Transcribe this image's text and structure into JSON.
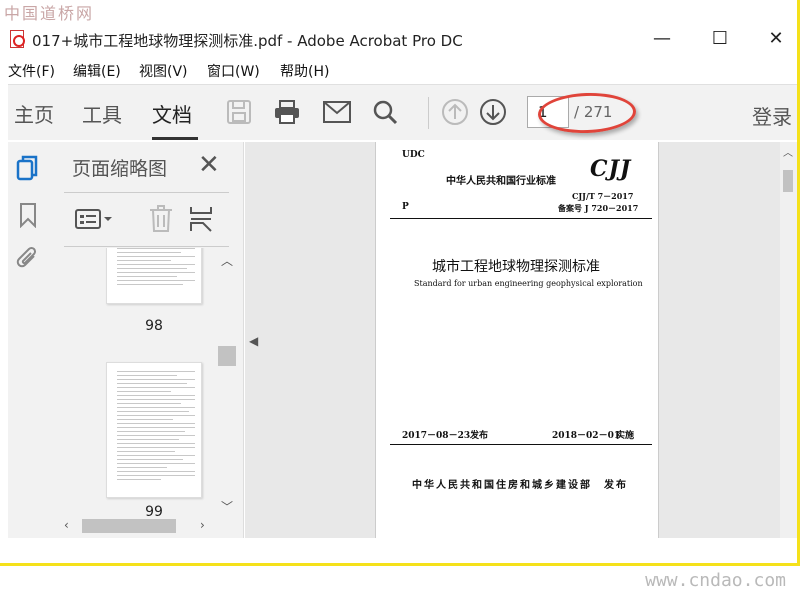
{
  "watermarks": {
    "top": "中国道桥网",
    "bottom": "www.cndao.com"
  },
  "window": {
    "title": "017+城市工程地球物理探测标准.pdf - Adobe Acrobat Pro DC",
    "minimize": "—",
    "maximize": "☐",
    "close": "✕"
  },
  "menu": [
    "文件(F)",
    "编辑(E)",
    "视图(V)",
    "窗口(W)",
    "帮助(H)"
  ],
  "toolbar": {
    "tabs": [
      "主页",
      "工具",
      "文档"
    ],
    "active_tab": "文档",
    "page_current": "1",
    "page_total": "/ 271",
    "login": "登录"
  },
  "panel": {
    "title": "页面缩略图",
    "close": "✕",
    "thumbnails": [
      {
        "label": "98"
      },
      {
        "label": "99"
      }
    ]
  },
  "document": {
    "udc": "UDC",
    "p": "P",
    "header": "中华人民共和国行业标准",
    "logo": "CJJ",
    "code": "CJJ/T 7－2017",
    "record": "备案号 J 720－2017",
    "title_cn": "城市工程地球物理探测标准",
    "title_en": "Standard for urban engineering geophysical exploration",
    "issue_date": "2017－08－23",
    "issue_label": "发布",
    "impl_date": "2018－02－01",
    "impl_label": "实施",
    "issuer": "中华人民共和国住房和城乡建设部",
    "issuer_label": "发布"
  },
  "colors": {
    "frame": "#f5e11a",
    "annotation": "#e0443a",
    "toolbar_bg": "#f2f2f2",
    "active_rail_icon": "#1a73c8"
  }
}
